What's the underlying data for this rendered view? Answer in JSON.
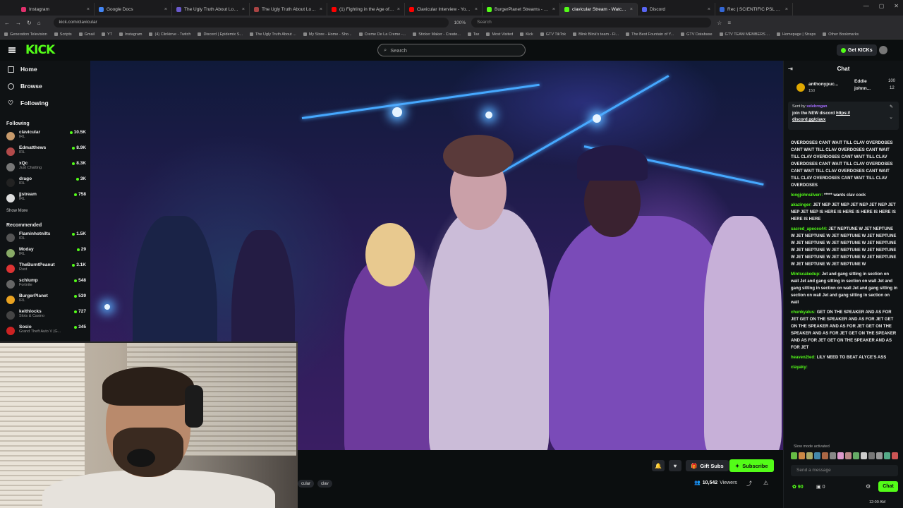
{
  "browser": {
    "tabs": [
      {
        "title": "Instagram",
        "color": "#e1306c"
      },
      {
        "title": "Google Docs",
        "color": "#4285f4"
      },
      {
        "title": "The Ugly Truth About Looksma",
        "color": "#6a5acd"
      },
      {
        "title": "The Ugly Truth About Looksma",
        "color": "#a44"
      },
      {
        "title": "(1) Fighting in the Age of Lonel",
        "color": "#f00"
      },
      {
        "title": "Clavicular Interview - YouTube",
        "color": "#f00"
      },
      {
        "title": "BurgerPlanet Streams - Watc",
        "color": "#53fc18"
      },
      {
        "title": "clavicular Stream - Watch L",
        "color": "#53fc18"
      },
      {
        "title": "Discord",
        "color": "#5865f2"
      },
      {
        "title": "Rec | SCIENTIFIC PSL SCALE CH",
        "color": "#3367d6"
      }
    ],
    "url": "kick.com/clavicular",
    "search_placeholder": "Search",
    "zoom": "100%",
    "bookmarks": [
      "Generation Television",
      "Scripts",
      "Gmail",
      "YT",
      "Instagram",
      "(4) Clinkinve - Twitch",
      "Discord | Epidemix S...",
      "The Ugly Truth About ...",
      "My Store - Home - Sho...",
      "Creme De La Creme -...",
      "Sticker Maker - Create...",
      "Tax",
      "Most Visited",
      "Kick",
      "GTV TikTok",
      "Blink Blink's team - Fi...",
      "The Best Fountain of Y...",
      "GTV Database",
      "GTV TEAM MEMBERS ...",
      "Homepage | Straps",
      "Other Bookmarks"
    ]
  },
  "header": {
    "logo": "KICK",
    "search_placeholder": "Search",
    "get_kicks": "Get KICKs"
  },
  "sidebar": {
    "nav": [
      {
        "label": "Home",
        "icon": "home-icon"
      },
      {
        "label": "Browse",
        "icon": "browse-icon"
      },
      {
        "label": "Following",
        "icon": "heart-icon"
      }
    ],
    "following_title": "Following",
    "following": [
      {
        "name": "clavicular",
        "category": "IRL",
        "viewers": "10.5K",
        "color": "#c79a6b"
      },
      {
        "name": "Edmatthews",
        "category": "IRL",
        "viewers": "8.9K",
        "color": "#b24a4a"
      },
      {
        "name": "xQc",
        "category": "Just Chatting",
        "viewers": "8.3K",
        "color": "#777"
      },
      {
        "name": "drago",
        "category": "IRL",
        "viewers": "3K",
        "color": "#222"
      },
      {
        "name": "jjstream",
        "category": "IRL",
        "viewers": "758",
        "color": "#ddd"
      }
    ],
    "show_more": "Show More",
    "recommended_title": "Recommended",
    "recommended": [
      {
        "name": "Flaminhotnilts",
        "category": "IRL",
        "viewers": "1.5K",
        "color": "#555"
      },
      {
        "name": "Moday",
        "category": "IRL",
        "viewers": "29",
        "color": "#8a6"
      },
      {
        "name": "TheBurntPeanut",
        "category": "Rust",
        "viewers": "3.1K",
        "color": "#d33"
      },
      {
        "name": "schlump",
        "category": "Fortnite",
        "viewers": "548",
        "color": "#666"
      },
      {
        "name": "BurgerPlanet",
        "category": "IRL",
        "viewers": "539",
        "color": "#e9a220"
      },
      {
        "name": "keithlocks",
        "category": "Slots & Casino",
        "viewers": "727",
        "color": "#444"
      },
      {
        "name": "Sosio",
        "category": "Grand Theft Auto V (G...",
        "viewers": "345",
        "color": "#c22"
      }
    ]
  },
  "stream": {
    "tags": [
      "cular",
      "clav"
    ],
    "viewers": "10,542",
    "viewers_label": "Viewers",
    "gift_subs": "Gift Subs",
    "subscribe": "Subscribe"
  },
  "chat": {
    "title": "Chat",
    "leaderboard": {
      "top_user": "anthonypuc...",
      "top_count": "150",
      "user2": "Eddie",
      "count2": "100",
      "user3": "johnn...",
      "count3": "12"
    },
    "pinned": {
      "sent_by": "Sent by",
      "author": "xelebrogan",
      "message": "join the NEW discord",
      "link": "https://",
      "link2": "discord.gg/clavx"
    },
    "messages": [
      {
        "user": "",
        "text": "OVERDOSES CANT WAIT TILL CLAV OVERDOSES CANT WAIT TILL CLAV OVERDOSES CANT WAIT TILL CLAV OVERDOSES CANT WAIT TILL CLAV OVERDOSES CANT WAIT TILL CLAV OVERDOSES CANT WAIT TILL CLAV OVERDOSES CANT WAIT TILL CLAV OVERDOSES CANT WAIT TILL CLAV OVERDOSES"
      },
      {
        "user": "longjohnsilverr:",
        "text": "***** wants clav cock"
      },
      {
        "user": "akazinger:",
        "text": "JET NEP JET NEP JET NEP JET NEP JET NEP JET NEP IS HERE IS HERE IS HERE IS HERE IS HERE IS HERE"
      },
      {
        "user": "sacred_apeces44:",
        "text": "JET NEPTUNE W JET NEPTUNE W JET NEPTUNE W JET NEPTUNE W JET NEPTUNE W JET NEPTUNE W JET NEPTUNE W JET NEPTUNE W JET NEPTUNE W JET NEPTUNE W JET NEPTUNE W JET NEPTUNE W JET NEPTUNE W JET NEPTUNE W JET NEPTUNE W JET NEPTUNE W"
      },
      {
        "user": "Mintscakedup:",
        "text": "Jet and gang sitting in section on wall Jet and gang sitting in section on wall Jet and gang sitting in section on wall Jet and gang sitting in section on wall Jet and gang sitting in section on wall"
      },
      {
        "user": "chunkyalus:",
        "text": "GET ON THE SPEAKER AND AS FOR JET GET ON THE SPEAKER AND AS FOR JET GET ON THE SPEAKER AND AS FOR JET GET ON THE SPEAKER AND AS FOR JET GET ON THE SPEAKER AND AS FOR JET GET ON THE SPEAKER AND AS FOR JET"
      },
      {
        "user": "heaven2ted:",
        "text": "LILY NEED TO BEAT ALYCE'S ASS"
      },
      {
        "user": "clayaky:",
        "text": ""
      }
    ],
    "slow_mode": "Slow mode activated",
    "input_placeholder": "Send a message",
    "kicks_count": "90",
    "other_count": "0",
    "chat_button": "Chat"
  },
  "system": {
    "clock": "12:00 AM"
  }
}
